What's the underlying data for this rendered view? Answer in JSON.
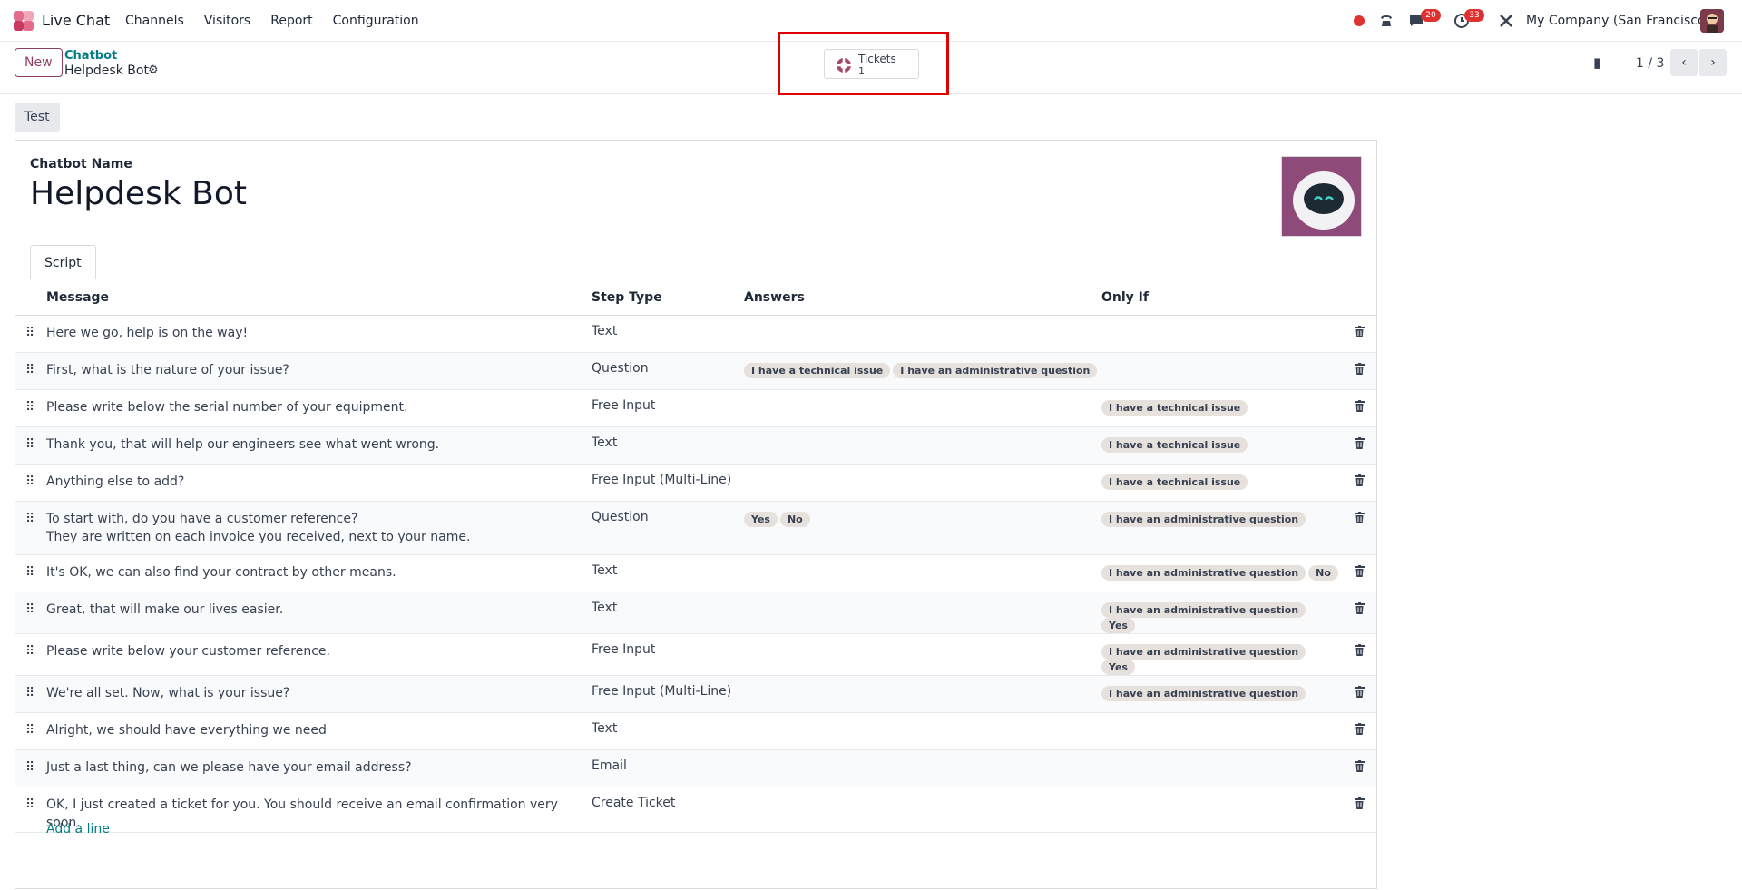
{
  "navbar": {
    "app_name": "Live Chat",
    "menu": [
      "Channels",
      "Visitors",
      "Report",
      "Configuration"
    ],
    "messages_badge": "20",
    "activities_badge": "33",
    "company": "My Company (San Francisco)"
  },
  "control_panel": {
    "new_label": "New",
    "breadcrumb_parent": "Chatbot",
    "breadcrumb_current": "Helpdesk Bot",
    "smart_button": {
      "label": "Tickets",
      "value": "1"
    },
    "pager": "1 / 3"
  },
  "form": {
    "test_label": "Test",
    "field_label": "Chatbot Name",
    "bot_name": "Helpdesk Bot",
    "tab_label": "Script",
    "columns": {
      "message": "Message",
      "step_type": "Step Type",
      "answers": "Answers",
      "only_if": "Only If"
    },
    "rows": [
      {
        "message": "Here we go, help is on the way!",
        "step_type": "Text",
        "answers": [],
        "only_if": []
      },
      {
        "message": "First, what is the nature of your issue?",
        "step_type": "Question",
        "answers": [
          "I have a technical issue",
          "I have an administrative question"
        ],
        "only_if": []
      },
      {
        "message": "Please write below the serial number of your equipment.",
        "step_type": "Free Input",
        "answers": [],
        "only_if": [
          "I have a technical issue"
        ]
      },
      {
        "message": "Thank you, that will help our engineers see what went wrong.",
        "step_type": "Text",
        "answers": [],
        "only_if": [
          "I have a technical issue"
        ]
      },
      {
        "message": "Anything else to add?",
        "step_type": "Free Input (Multi-Line)",
        "answers": [],
        "only_if": [
          "I have a technical issue"
        ]
      },
      {
        "message": "To start with, do you have a customer reference?",
        "message2": "They are written on each invoice you received, next to your name.",
        "step_type": "Question",
        "answers": [
          "Yes",
          "No"
        ],
        "only_if": [
          "I have an administrative question"
        ]
      },
      {
        "message": "It's OK, we can also find your contract by other means.",
        "step_type": "Text",
        "answers": [],
        "only_if": [
          "I have an administrative question",
          "No"
        ]
      },
      {
        "message": "Great, that will make our lives easier.",
        "step_type": "Text",
        "answers": [],
        "only_if": [
          "I have an administrative question",
          "Yes"
        ]
      },
      {
        "message": "Please write below your customer reference.",
        "step_type": "Free Input",
        "answers": [],
        "only_if": [
          "I have an administrative question",
          "Yes"
        ]
      },
      {
        "message": "We're all set. Now, what is your issue?",
        "step_type": "Free Input (Multi-Line)",
        "answers": [],
        "only_if": [
          "I have an administrative question"
        ]
      },
      {
        "message": "Alright, we should have everything we need",
        "step_type": "Text",
        "answers": [],
        "only_if": []
      },
      {
        "message": "Just a last thing, can we please have your email address?",
        "step_type": "Email",
        "answers": [],
        "only_if": []
      },
      {
        "message": "OK, I just created a ticket for you. You should receive an email confirmation very soon.",
        "step_type": "Create Ticket",
        "answers": [],
        "only_if": []
      }
    ],
    "add_line_label": "Add a line"
  },
  "colors": {
    "brand": "#8f3e63",
    "link": "#017e84",
    "highlight": "#e00000",
    "badge": "#e03131"
  }
}
